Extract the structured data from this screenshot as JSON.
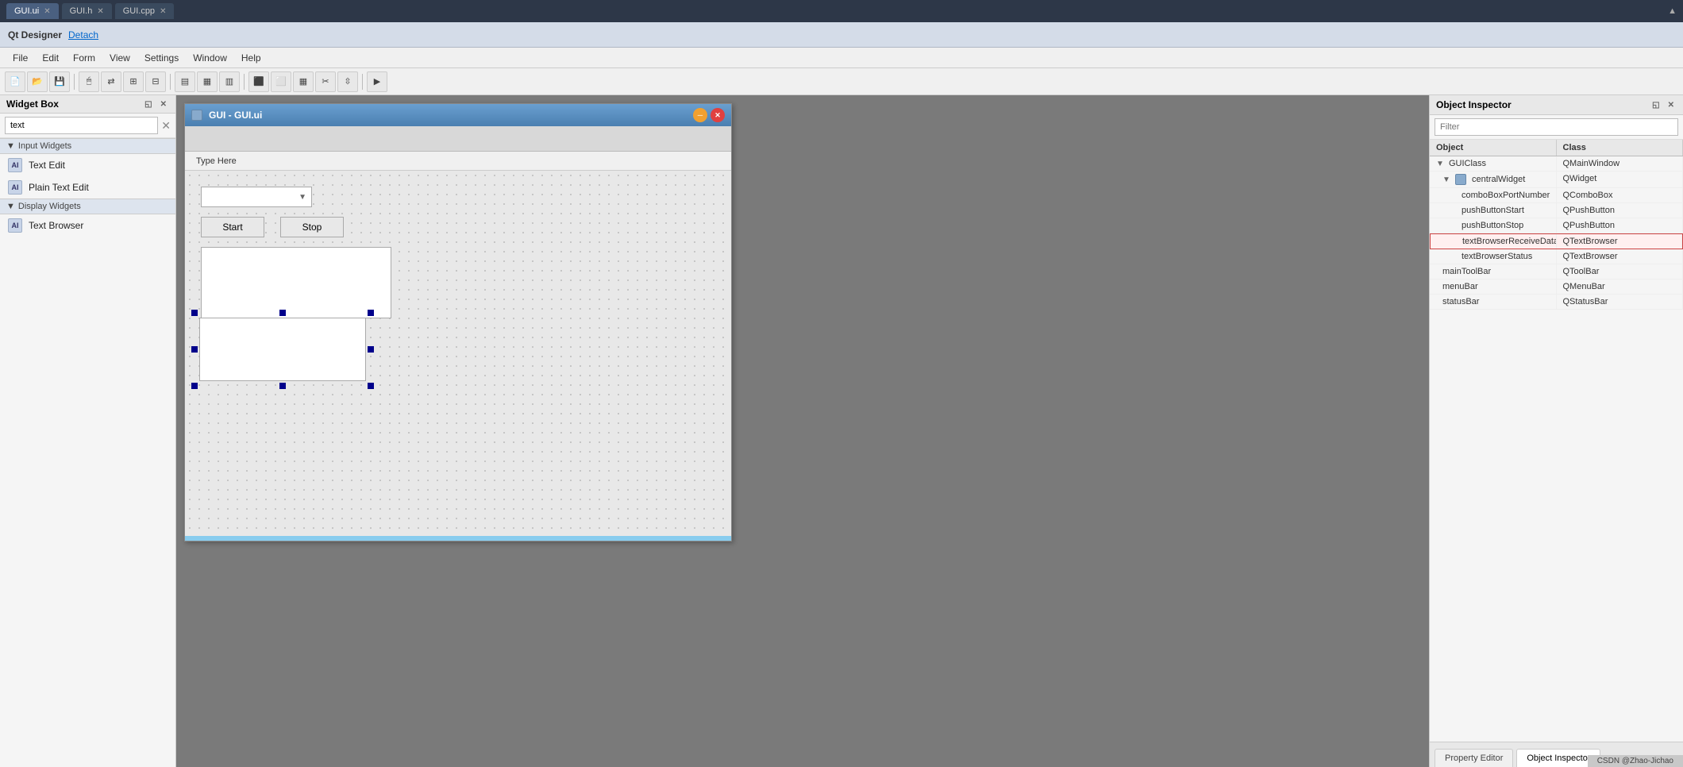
{
  "titlebar": {
    "tabs": [
      {
        "label": "GUI.ui",
        "active": true,
        "closable": true
      },
      {
        "label": "GUI.h",
        "active": false,
        "closable": true
      },
      {
        "label": "GUI.cpp",
        "active": false,
        "closable": true
      }
    ]
  },
  "qt_bar": {
    "label": "Qt Designer",
    "detach_link": "Detach"
  },
  "menu": {
    "items": [
      "File",
      "Edit",
      "Form",
      "View",
      "Settings",
      "Window",
      "Help"
    ]
  },
  "toolbar": {
    "buttons": [
      "new",
      "open",
      "save",
      "sep",
      "widget-mode",
      "connection-mode",
      "sep",
      "align-left",
      "align-center",
      "align-right",
      "sep",
      "layout-h",
      "layout-v",
      "layout-grid",
      "break-layout",
      "sep",
      "preview"
    ]
  },
  "widget_box": {
    "title": "Widget Box",
    "search_placeholder": "text",
    "sections": [
      {
        "name": "Input Widgets",
        "items": [
          {
            "label": "Text Edit",
            "icon": "AI"
          },
          {
            "label": "Plain Text Edit",
            "icon": "AI"
          }
        ]
      },
      {
        "name": "Display Widgets",
        "items": [
          {
            "label": "Text Browser",
            "icon": "AI"
          }
        ]
      }
    ]
  },
  "gui_window": {
    "title": "GUI - GUI.ui",
    "menu_items": [
      "Type Here"
    ],
    "combo_placeholder": "",
    "start_button": "Start",
    "stop_button": "Stop"
  },
  "object_inspector": {
    "title": "Object Inspector",
    "filter_placeholder": "Filter",
    "col_object": "Object",
    "col_class": "Class",
    "rows": [
      {
        "indent": 0,
        "expand": true,
        "icon": false,
        "object": "GUIClass",
        "class": "QMainWindow"
      },
      {
        "indent": 1,
        "expand": true,
        "icon": true,
        "object": "centralWidget",
        "class": "QWidget"
      },
      {
        "indent": 2,
        "expand": false,
        "icon": false,
        "object": "comboBoxPortNumber",
        "class": "QComboBox"
      },
      {
        "indent": 2,
        "expand": false,
        "icon": false,
        "object": "pushButtonStart",
        "class": "QPushButton"
      },
      {
        "indent": 2,
        "expand": false,
        "icon": false,
        "object": "pushButtonStop",
        "class": "QPushButton"
      },
      {
        "indent": 2,
        "expand": false,
        "icon": false,
        "object": "textBrowserReceiveData",
        "class": "QTextBrowser",
        "highlighted": true
      },
      {
        "indent": 2,
        "expand": false,
        "icon": false,
        "object": "textBrowserStatus",
        "class": "QTextBrowser"
      },
      {
        "indent": 1,
        "expand": false,
        "icon": false,
        "object": "mainToolBar",
        "class": "QToolBar"
      },
      {
        "indent": 1,
        "expand": false,
        "icon": false,
        "object": "menuBar",
        "class": "QMenuBar"
      },
      {
        "indent": 1,
        "expand": false,
        "icon": false,
        "object": "statusBar",
        "class": "QStatusBar"
      }
    ],
    "bottom_tabs": [
      {
        "label": "Property Editor",
        "active": false
      },
      {
        "label": "Object Inspector",
        "active": true
      }
    ]
  },
  "status_bar": {
    "text": "CSDN @Zhao-Jichao"
  }
}
